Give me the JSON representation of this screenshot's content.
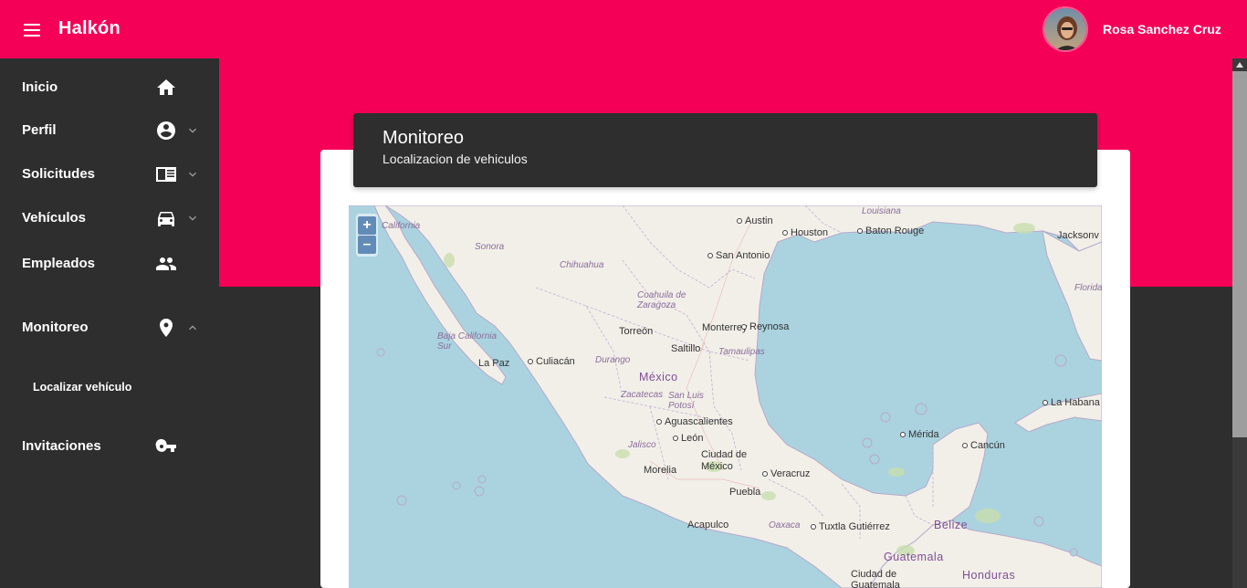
{
  "app": {
    "title": "Halkón"
  },
  "user": {
    "name": "Rosa Sanchez Cruz"
  },
  "sidebar": {
    "items": [
      {
        "label": "Inicio",
        "icon": "home-icon"
      },
      {
        "label": "Perfil",
        "icon": "account-circle-icon"
      },
      {
        "label": "Solicitudes",
        "icon": "document-icon"
      },
      {
        "label": "Vehículos",
        "icon": "car-icon"
      },
      {
        "label": "Empleados",
        "icon": "people-icon"
      },
      {
        "label": "Monitoreo",
        "icon": "map-pin-icon"
      },
      {
        "label": "Invitaciones",
        "icon": "key-icon"
      }
    ],
    "submenu": {
      "label": "Localizar vehículo"
    }
  },
  "card": {
    "title": "Monitoreo",
    "subtitle": "Localizacion de vehiculos"
  },
  "map": {
    "zoom_in": "+",
    "zoom_out": "–",
    "labels": {
      "austin": "Austin",
      "houston": "Houston",
      "baton_rouge": "Baton Rouge",
      "louisiana": "Louisiana",
      "jacksonville": "Jacksonv",
      "florida": "Florida",
      "california": "California",
      "sonora": "Sonora",
      "chihuahua": "Chihuahua",
      "san_antonio": "San Antonio",
      "coahuila": "Coahuila de Zaragoza",
      "baja_california_sur": "Baja California Sur",
      "torreon": "Torreón",
      "monterrey": "Monterrey",
      "reynosa": "Reynosa",
      "saltillo": "Saltillo",
      "tamaulipas": "Tamaulipas",
      "la_paz": "La Paz",
      "culiacan": "Culiacán",
      "durango": "Durango",
      "mexico": "México",
      "zacatecas": "Zacatecas",
      "san_luis_potosi": "San Luis Potosí",
      "la_habana": "La Habana",
      "aguascalientes": "Aguascalientes",
      "merida": "Mérida",
      "cancun": "Cancún",
      "jalisco": "Jalisco",
      "leon": "León",
      "ciudad_de_mexico": "Ciudad de México",
      "morelia": "Morelia",
      "veracruz": "Veracruz",
      "puebla": "Puebla",
      "acapulco": "Acapulco",
      "oaxaca": "Oaxaca",
      "tuxtla": "Tuxtla Gutiérrez",
      "belize": "Belize",
      "guatemala": "Guatemala",
      "ciudad_de_guatemala": "Ciudad de Guatemala",
      "honduras": "Honduras"
    }
  },
  "colors": {
    "accent": "#f50057",
    "sidebar": "#2e2e2e",
    "water": "#aad3df",
    "land": "#f2efe9"
  }
}
